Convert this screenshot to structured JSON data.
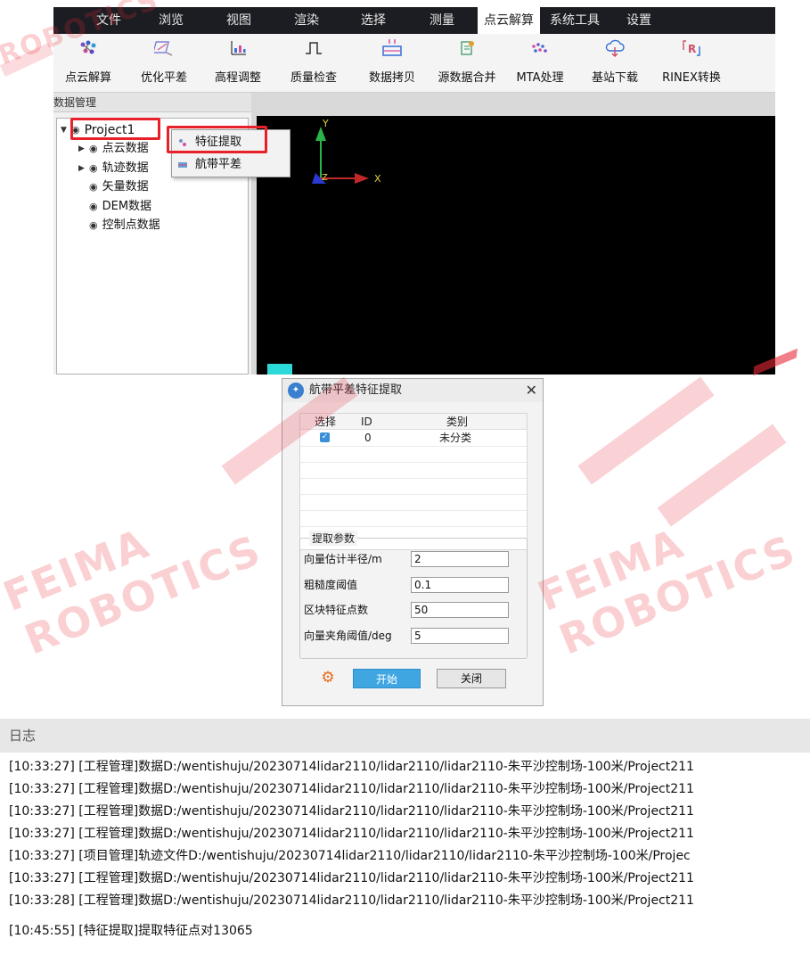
{
  "menubar": {
    "items": [
      {
        "label": "文件",
        "active": false
      },
      {
        "label": "浏览",
        "active": false
      },
      {
        "label": "视图",
        "active": false
      },
      {
        "label": "渲染",
        "active": false
      },
      {
        "label": "选择",
        "active": false
      },
      {
        "label": "测量",
        "active": false
      },
      {
        "label": "点云解算",
        "active": true
      },
      {
        "label": "系统工具",
        "active": false
      },
      {
        "label": "设置",
        "active": false
      }
    ]
  },
  "toolbar": {
    "tools": [
      {
        "label": "点云解算",
        "icon": "point-cloud-solve-icon"
      },
      {
        "label": "优化平差",
        "icon": "optimize-adjust-icon"
      },
      {
        "label": "高程调整",
        "icon": "elevation-adjust-icon"
      },
      {
        "label": "质量检查",
        "icon": "quality-check-icon"
      },
      {
        "label": "数据拷贝",
        "icon": "data-copy-icon"
      },
      {
        "label": "源数据合并",
        "icon": "source-merge-icon"
      },
      {
        "label": "MTA处理",
        "icon": "mta-process-icon"
      },
      {
        "label": "基站下载",
        "icon": "cloud-download-icon"
      },
      {
        "label": "RINEX转换",
        "icon": "rinex-convert-icon"
      }
    ]
  },
  "data_manager": {
    "title": "数据管理",
    "tree": {
      "root": "Project1",
      "children": [
        "点云数据",
        "轨迹数据",
        "矢量数据",
        "DEM数据",
        "控制点数据"
      ]
    }
  },
  "context_menu": {
    "items": [
      {
        "label": "特征提取",
        "icon": "feature-extract-icon"
      },
      {
        "label": "航带平差",
        "icon": "strip-adjust-icon"
      }
    ]
  },
  "viewport": {
    "axis_y": "Y",
    "axis_x": "X",
    "axis_z": "Z"
  },
  "dialog": {
    "title": "航带平差特征提取",
    "close_glyph": "✕",
    "table": {
      "headers": [
        "选择",
        "ID",
        "类别"
      ],
      "rows": [
        {
          "checked": true,
          "id": "0",
          "category": "未分类"
        }
      ]
    },
    "params_title": "提取参数",
    "params": [
      {
        "label": "向量估计半径/m",
        "value": "2"
      },
      {
        "label": "粗糙度阈值",
        "value": "0.1"
      },
      {
        "label": "区块特征点数",
        "value": "50"
      },
      {
        "label": "向量夹角阈值/deg",
        "value": "5"
      }
    ],
    "start_label": "开始",
    "close_label": "关闭"
  },
  "log": {
    "title": "日志",
    "lines": [
      "[10:33:27] [工程管理]数据D:/wentishuju/20230714lidar2110/lidar2110/lidar2110-朱平沙控制场-100米/Project211",
      "[10:33:27] [工程管理]数据D:/wentishuju/20230714lidar2110/lidar2110/lidar2110-朱平沙控制场-100米/Project211",
      "[10:33:27] [工程管理]数据D:/wentishuju/20230714lidar2110/lidar2110/lidar2110-朱平沙控制场-100米/Project211",
      "[10:33:27] [工程管理]数据D:/wentishuju/20230714lidar2110/lidar2110/lidar2110-朱平沙控制场-100米/Project211",
      "[10:33:27] [项目管理]轨迹文件D:/wentishuju/20230714lidar2110/lidar2110/lidar2110-朱平沙控制场-100米/Projec",
      "[10:33:27] [工程管理]数据D:/wentishuju/20230714lidar2110/lidar2110/lidar2110-朱平沙控制场-100米/Project211",
      "[10:33:28] [工程管理]数据D:/wentishuju/20230714lidar2110/lidar2110/lidar2110-朱平沙控制场-100米/Project211",
      "[10:45:55] [特征提取]提取特征点对13065"
    ]
  },
  "watermark": {
    "line1": "FEIMA",
    "line2": "ROBOTICS",
    "color": "#e62837"
  },
  "colors": {
    "accent": "#3fa6e2",
    "highlight_box": "#e8202a",
    "menubar_bg": "#1c1d22"
  }
}
